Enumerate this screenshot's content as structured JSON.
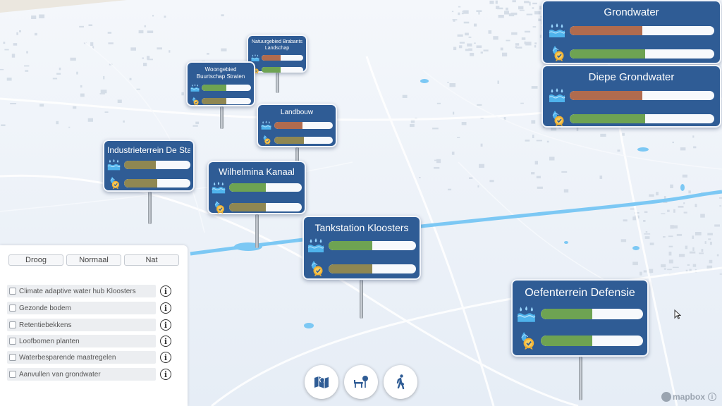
{
  "colors": {
    "card_bg": "#2f5c95",
    "bar_green": "#6ea352",
    "bar_brown": "#b06b4e",
    "bar_olive": "#8f8752",
    "bar_track": "#f7f9fc",
    "water_canal": "#7cc8f4"
  },
  "locations": [
    {
      "name": "Natuurgebied Brabants Landschap",
      "water_level": 0.45,
      "water_color": "brown",
      "quality_level": 0.45,
      "quality_color": "green",
      "water_icon": "water-drops-icon",
      "quality_icon": "water-quality-badge-icon"
    },
    {
      "name": "Woongebied Buurtschap Straten",
      "water_level": 0.5,
      "water_color": "green",
      "quality_level": 0.5,
      "quality_color": "olive",
      "water_icon": "water-drops-icon",
      "quality_icon": "water-quality-badge-icon"
    },
    {
      "name": "Landbouw",
      "water_level": 0.48,
      "water_color": "brown",
      "quality_level": 0.5,
      "quality_color": "olive",
      "water_icon": "water-drops-icon",
      "quality_icon": "water-quality-badge-icon"
    },
    {
      "name": "Industrieterrein De Stad",
      "water_level": 0.48,
      "water_color": "olive",
      "quality_level": 0.5,
      "quality_color": "olive",
      "water_icon": "water-drops-icon",
      "quality_icon": "water-quality-badge-icon"
    },
    {
      "name": "Wilhelmina Kanaal",
      "water_level": 0.5,
      "water_color": "green",
      "quality_level": 0.5,
      "quality_color": "olive",
      "water_icon": "water-drops-icon",
      "quality_icon": "water-quality-badge-icon"
    },
    {
      "name": "Tankstation Kloosters",
      "water_level": 0.5,
      "water_color": "green",
      "quality_level": 0.5,
      "quality_color": "olive",
      "water_icon": "water-drops-icon",
      "quality_icon": "water-quality-badge-icon"
    },
    {
      "name": "Oefenterrein Defensie",
      "water_level": 0.5,
      "water_color": "green",
      "quality_level": 0.5,
      "quality_color": "green",
      "water_icon": "water-drops-icon",
      "quality_icon": "water-quality-badge-icon"
    },
    {
      "name": "Grondwater",
      "water_level": 0.5,
      "water_color": "brown",
      "quality_level": 0.52,
      "quality_color": "green",
      "water_icon": "water-drops-icon",
      "quality_icon": "water-quality-badge-icon"
    },
    {
      "name": "Diepe Grondwater",
      "water_level": 0.5,
      "water_color": "brown",
      "quality_level": 0.52,
      "quality_color": "green",
      "water_icon": "water-drops-icon",
      "quality_icon": "water-quality-badge-icon"
    }
  ],
  "panel": {
    "scenario_buttons": [
      "Droog",
      "Normaal",
      "Nat"
    ],
    "measures": [
      "Climate adaptive water hub Kloosters",
      "Gezonde bodem",
      "Retentiebekkens",
      "Loofbomen planten",
      "Waterbesparende maatregelen",
      "Aanvullen van grondwater"
    ],
    "info_icon": "info-icon",
    "info_glyph": "i"
  },
  "toolbar": [
    {
      "icon": "map-pin-icon"
    },
    {
      "icon": "bench-tree-icon"
    },
    {
      "icon": "walking-person-icon"
    }
  ],
  "attribution": {
    "text": "mapbox",
    "info_glyph": "i"
  }
}
